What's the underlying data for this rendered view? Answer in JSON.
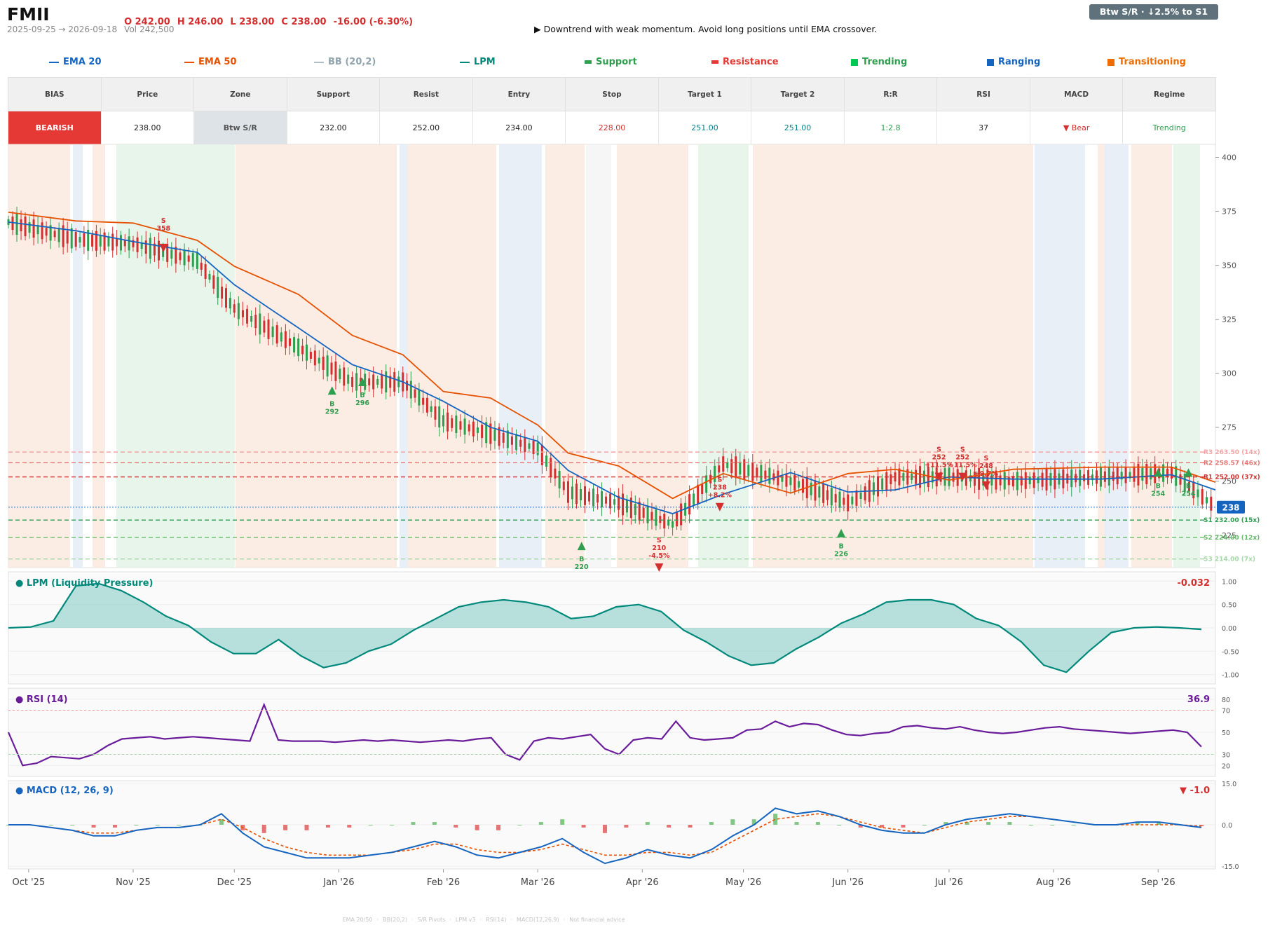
{
  "header": {
    "ticker": "FMII",
    "open": "O 242.00",
    "high": "H 246.00",
    "low": "L 238.00",
    "close": "C 238.00",
    "change": "-16.00 (-6.30%)",
    "date_range": "2025-09-25 → 2026-09-18",
    "volume": "Vol 242,500",
    "message": "▶  Downtrend with weak momentum. Avoid long positions until EMA crossover.",
    "badge": "Btw S/R  ·  ↓2.5% to S1"
  },
  "legend": [
    {
      "label": "EMA 20",
      "color": "#1565c0",
      "kind": "line"
    },
    {
      "label": "EMA 50",
      "color": "#e65100",
      "kind": "line"
    },
    {
      "label": "BB (20,2)",
      "color": "#90a4ae",
      "kind": "line"
    },
    {
      "label": "LPM",
      "color": "#00897b",
      "kind": "line"
    },
    {
      "label": "Support",
      "color": "#2e9e4f",
      "kind": "bar"
    },
    {
      "label": "Resistance",
      "color": "#e53935",
      "kind": "bar"
    },
    {
      "label": "Trending",
      "color": "#00c853",
      "kind": "sq"
    },
    {
      "label": "Ranging",
      "color": "#1565c0",
      "kind": "sq"
    },
    {
      "label": "Transitioning",
      "color": "#ef6c00",
      "kind": "sq"
    }
  ],
  "signal_table": {
    "headers": [
      "BIAS",
      "Price",
      "Zone",
      "Support",
      "Resist",
      "Entry",
      "Stop",
      "Target 1",
      "Target 2",
      "R:R",
      "RSI",
      "MACD",
      "Regime"
    ],
    "values": [
      "BEARISH",
      "238.00",
      "Btw S/R",
      "232.00",
      "252.00",
      "234.00",
      "228.00",
      "251.00",
      "251.00",
      "1:2.8",
      "37",
      "▼ Bear",
      "Trending"
    ]
  },
  "colors": {
    "up": "#2e9e4f",
    "down": "#d32f2f",
    "ema20": "#1565c0",
    "ema50": "#e65100",
    "lpm": "#00897b",
    "rsi": "#6a1b9a",
    "macd": "#1565c0",
    "signal": "#e65100"
  },
  "footer": [
    "EMA 20/50",
    "BB(20,2)",
    "S/R Pivots",
    "LPM v3",
    "RSI(14)",
    "MACD(12,26,9)",
    "Not financial advice"
  ],
  "chart_data": [
    {
      "type": "candlestick",
      "title": "FMII",
      "x_ticks": [
        "Oct '25",
        "Nov '25",
        "Dec '25",
        "Jan '26",
        "Feb '26",
        "Mar '26",
        "Apr '26",
        "May '26",
        "Jun '26",
        "Jul '26",
        "Aug '26",
        "Sep '26"
      ],
      "y_ticks": [
        400,
        375,
        350,
        325,
        300,
        275,
        250,
        225
      ],
      "ylim": [
        210,
        406
      ],
      "last_price": "238",
      "close_trend": [
        [
          "2025-09-25",
          370
        ],
        [
          "2025-10-15",
          362
        ],
        [
          "2025-11-01",
          360
        ],
        [
          "2025-11-20",
          352
        ],
        [
          "2025-12-01",
          330
        ],
        [
          "2025-12-20",
          312
        ],
        [
          "2026-01-05",
          296
        ],
        [
          "2026-01-20",
          296
        ],
        [
          "2026-02-01",
          278
        ],
        [
          "2026-02-15",
          272
        ],
        [
          "2026-03-01",
          265
        ],
        [
          "2026-03-10",
          245
        ],
        [
          "2026-03-25",
          240
        ],
        [
          "2026-04-10",
          230
        ],
        [
          "2026-04-25",
          258
        ],
        [
          "2026-05-15",
          250
        ],
        [
          "2026-06-01",
          240
        ],
        [
          "2026-06-15",
          252
        ],
        [
          "2026-07-01",
          252
        ],
        [
          "2026-07-20",
          250
        ],
        [
          "2026-08-15",
          252
        ],
        [
          "2026-09-05",
          254
        ],
        [
          "2026-09-18",
          238
        ]
      ],
      "levels": [
        {
          "label": "R3 263.50 (14x)",
          "value": 263.5,
          "color": "#f4a4a4"
        },
        {
          "label": "R2 258.57 (46x)",
          "value": 258.57,
          "color": "#e57373"
        },
        {
          "label": "R1 252.00 (37x)",
          "value": 252,
          "color": "#d32f2f"
        },
        {
          "label": "S1 232.00 (15x)",
          "value": 232,
          "color": "#2e9e4f"
        },
        {
          "label": "S2 224.00 (12x)",
          "value": 224,
          "color": "#66bb6a"
        },
        {
          "label": "S3 214.00 (7x)",
          "value": 214,
          "color": "#a5d6a7"
        }
      ],
      "signals": [
        {
          "side": "S",
          "text": "358",
          "date": "2025-11-10",
          "price": 358
        },
        {
          "side": "B",
          "text": "292",
          "date": "2025-12-30",
          "price": 292
        },
        {
          "side": "B",
          "text": "296",
          "date": "2026-01-08",
          "price": 296
        },
        {
          "side": "B",
          "text": "220",
          "date": "2026-03-14",
          "price": 220
        },
        {
          "side": "S",
          "text": "210 -4.5%",
          "date": "2026-04-06",
          "price": 210
        },
        {
          "side": "S",
          "text": "238 +8.2%",
          "date": "2026-04-24",
          "price": 238
        },
        {
          "side": "B",
          "text": "226",
          "date": "2026-05-30",
          "price": 226
        },
        {
          "side": "S",
          "text": "252 +11.5%",
          "date": "2026-06-28",
          "price": 252
        },
        {
          "side": "S",
          "text": "252 +11.5%",
          "date": "2026-07-05",
          "price": 252
        },
        {
          "side": "S",
          "text": "248 +9.7%",
          "date": "2026-07-12",
          "price": 248
        },
        {
          "side": "B",
          "text": "254",
          "date": "2026-09-01",
          "price": 254
        },
        {
          "side": "B",
          "text": "254",
          "date": "2026-09-10",
          "price": 254
        }
      ]
    },
    {
      "type": "area",
      "title": "LPM (Liquidity Pressure)",
      "last_value": "-0.032",
      "y_ticks": [
        "1.00",
        "0.50",
        "0.00",
        "-0.50",
        "-1.00"
      ],
      "ylim": [
        -1.2,
        1.2
      ],
      "points": [
        0,
        0.02,
        0.15,
        0.9,
        0.95,
        0.8,
        0.55,
        0.25,
        0.05,
        -0.3,
        -0.55,
        -0.55,
        -0.25,
        -0.6,
        -0.85,
        -0.75,
        -0.5,
        -0.35,
        -0.05,
        0.2,
        0.45,
        0.55,
        0.6,
        0.55,
        0.45,
        0.2,
        0.25,
        0.45,
        0.5,
        0.35,
        -0.05,
        -0.3,
        -0.6,
        -0.8,
        -0.75,
        -0.45,
        -0.2,
        0.1,
        0.3,
        0.55,
        0.6,
        0.6,
        0.5,
        0.2,
        0.05,
        -0.3,
        -0.8,
        -0.95,
        -0.5,
        -0.1,
        0.0,
        0.02,
        0.0,
        -0.032
      ]
    },
    {
      "type": "line",
      "title": "RSI (14)",
      "last_value": "36.9",
      "y_ticks": [
        "80",
        "70",
        "50",
        "30",
        "20"
      ],
      "ylim": [
        10,
        90
      ],
      "points": [
        50,
        20,
        22,
        28,
        27,
        26,
        30,
        38,
        44,
        45,
        46,
        44,
        45,
        46,
        45,
        44,
        43,
        42,
        75,
        43,
        42,
        42,
        42,
        41,
        42,
        43,
        42,
        43,
        42,
        41,
        42,
        43,
        42,
        44,
        45,
        30,
        25,
        42,
        45,
        44,
        46,
        48,
        35,
        30,
        43,
        45,
        44,
        60,
        45,
        43,
        44,
        45,
        52,
        53,
        60,
        55,
        58,
        57,
        52,
        48,
        47,
        49,
        50,
        55,
        56,
        54,
        53,
        55,
        52,
        50,
        49,
        50,
        52,
        54,
        55,
        53,
        52,
        51,
        50,
        49,
        50,
        51,
        52,
        50,
        36.9
      ]
    },
    {
      "type": "line",
      "title": "MACD (12, 26, 9)",
      "last_value": "▼ -1.0",
      "y_ticks": [
        "15.0",
        "0.0",
        "-15.0"
      ],
      "ylim": [
        -16,
        16
      ],
      "macd": [
        0,
        0,
        -1,
        -2,
        -4,
        -4,
        -2,
        -1,
        -1,
        0,
        4,
        -3,
        -8,
        -10,
        -12,
        -12,
        -12,
        -11,
        -10,
        -8,
        -6,
        -8,
        -11,
        -12,
        -10,
        -8,
        -5,
        -10,
        -14,
        -12,
        -9,
        -11,
        -12,
        -9,
        -4,
        0,
        6,
        4,
        5,
        3,
        0,
        -2,
        -3,
        -3,
        0,
        2,
        3,
        4,
        3,
        2,
        1,
        0,
        0,
        1,
        1,
        0,
        -1
      ],
      "signal": [
        0,
        0,
        -1,
        -2,
        -3,
        -3,
        -2,
        -1,
        -1,
        0,
        2,
        -1,
        -5,
        -8,
        -10,
        -11,
        -11,
        -11,
        -10,
        -9,
        -7,
        -7,
        -9,
        -10,
        -10,
        -9,
        -7,
        -9,
        -11,
        -11,
        -10,
        -10,
        -11,
        -10,
        -6,
        -2,
        2,
        3,
        4,
        3,
        1,
        -1,
        -2,
        -3,
        -1,
        1,
        2,
        3,
        3,
        2,
        1,
        0,
        0,
        0,
        0,
        0,
        -0.5
      ]
    }
  ]
}
